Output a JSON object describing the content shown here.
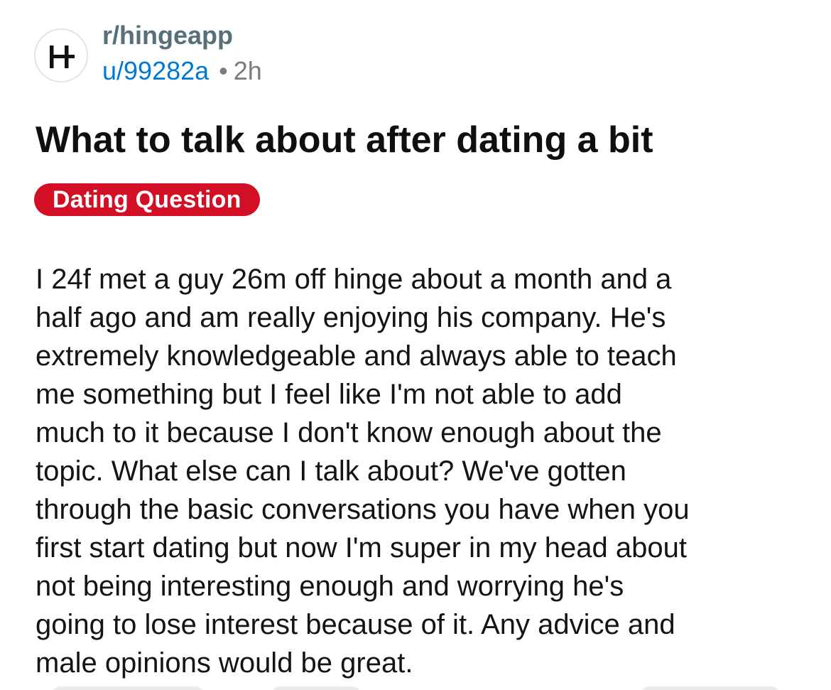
{
  "post": {
    "subreddit": "r/hingeapp",
    "author": "u/99282a",
    "separator": "•",
    "time": "2h",
    "avatar_icon": "hinge-logo-icon",
    "title": "What to talk about after dating a bit",
    "flair": "Dating Question",
    "flair_color": "#d20f24",
    "body_lines": [
      "I 24f met a guy 26m off hinge about a month and a",
      "half ago and am really enjoying his company. He's",
      "extremely knowledgeable and always able to teach",
      "me something but I feel like I'm not able to add",
      "much to it because I don't know enough about the",
      "topic. What else can I talk about? We've gotten",
      "through the basic conversations you have when you",
      "first start dating but now I'm super in my head about",
      "not being interesting enough and worrying he's",
      "going to lose interest because of it. Any advice and",
      "male opinions would be great."
    ]
  },
  "colors": {
    "username": "#0079d3",
    "meta": "#7c7c7c",
    "subreddit": "#576f76"
  }
}
